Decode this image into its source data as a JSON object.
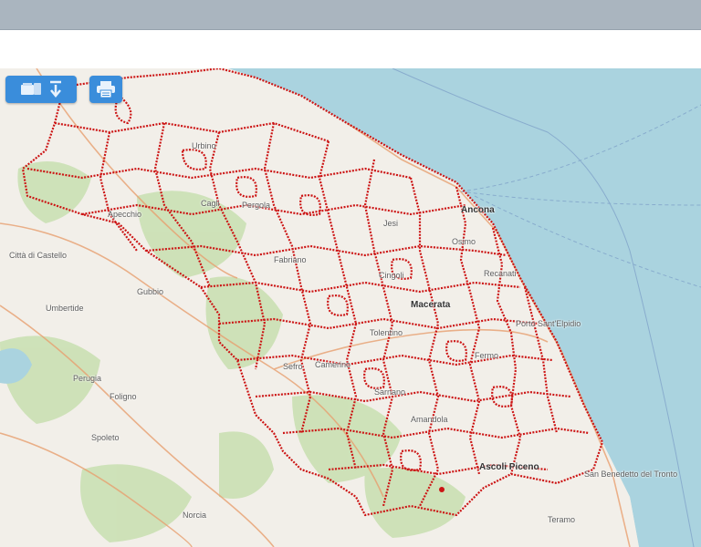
{
  "toolbar": {
    "export_button": {
      "icon_left": "layers-icon",
      "icon_right": "download-arrow-icon"
    },
    "print_button": {
      "icon": "printer-icon"
    },
    "accent": "#3a8ddb"
  },
  "map": {
    "colors": {
      "sea": "#aad3df",
      "land": "#f2efe9",
      "forest": "#c8dfb0",
      "boundary": "#cc1414",
      "road": "#e8a070"
    },
    "places": [
      {
        "name": "Urbino",
        "kind": "town"
      },
      {
        "name": "Cagli",
        "kind": "town"
      },
      {
        "name": "Pergola",
        "kind": "town"
      },
      {
        "name": "Apecchio",
        "kind": "town"
      },
      {
        "name": "Ancona",
        "kind": "city"
      },
      {
        "name": "Jesi",
        "kind": "town"
      },
      {
        "name": "Osimo",
        "kind": "town"
      },
      {
        "name": "Fabriano",
        "kind": "town"
      },
      {
        "name": "Cingoli",
        "kind": "town"
      },
      {
        "name": "Macerata",
        "kind": "city"
      },
      {
        "name": "Tolentino",
        "kind": "town"
      },
      {
        "name": "Camerino",
        "kind": "town"
      },
      {
        "name": "Sefro",
        "kind": "town"
      },
      {
        "name": "Recanati",
        "kind": "town"
      },
      {
        "name": "Fermo",
        "kind": "town"
      },
      {
        "name": "Porto Sant'Elpidio",
        "kind": "town"
      },
      {
        "name": "Sarnano",
        "kind": "town"
      },
      {
        "name": "Amandola",
        "kind": "town"
      },
      {
        "name": "Ascoli Piceno",
        "kind": "city"
      },
      {
        "name": "San Benedetto del Tronto",
        "kind": "town"
      },
      {
        "name": "Gubbio",
        "kind": "town"
      },
      {
        "name": "Perugia",
        "kind": "town"
      },
      {
        "name": "Foligno",
        "kind": "town"
      },
      {
        "name": "Spoleto",
        "kind": "town"
      },
      {
        "name": "Norcia",
        "kind": "town"
      },
      {
        "name": "Città di Castello",
        "kind": "town"
      },
      {
        "name": "Umbertide",
        "kind": "town"
      },
      {
        "name": "Teramo",
        "kind": "town"
      }
    ]
  }
}
